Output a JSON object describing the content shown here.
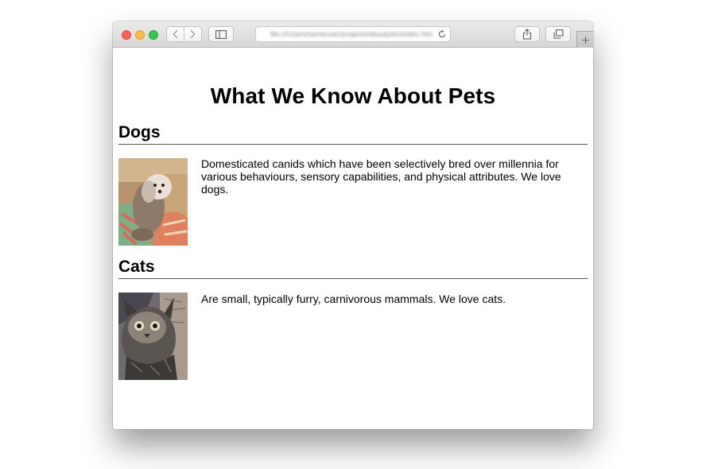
{
  "browser": {
    "url": "file:///Users/someuser/projects/aboutpets/index.html",
    "buttons": {
      "back": "chevron-left-icon",
      "forward": "chevron-right-icon",
      "sidebar": "sidebar-icon",
      "reload": "reload-icon",
      "share": "share-icon",
      "tabs": "tab-overview-icon",
      "new_tab": "plus-icon"
    },
    "colors": {
      "close": "#fc605b",
      "minimize": "#fdbc40",
      "zoom": "#34c84a"
    }
  },
  "page": {
    "title": "What We Know About Pets",
    "sections": [
      {
        "heading": "Dogs",
        "text": "Domesticated canids which have been selectively bred over millennia for various behaviours, sensory capabilities, and physical attributes. We love dogs."
      },
      {
        "heading": "Cats",
        "text": "Are small, typically furry, carnivorous mammals. We love cats."
      }
    ]
  }
}
